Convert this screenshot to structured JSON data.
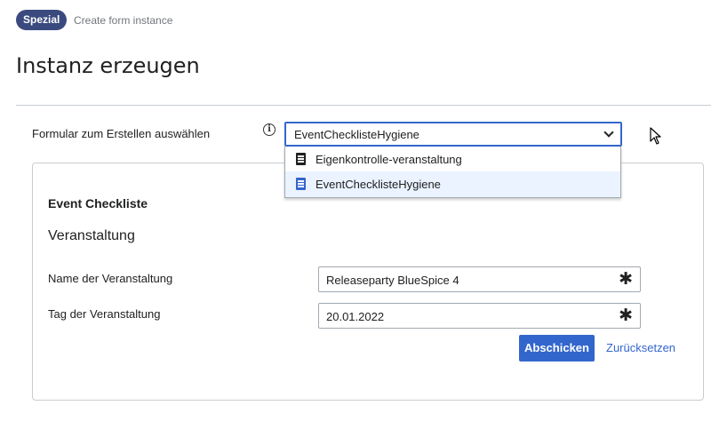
{
  "breadcrumb": {
    "badge": "Spezial",
    "text": "Create form instance"
  },
  "page": {
    "title": "Instanz erzeugen"
  },
  "form_select": {
    "label": "Formular zum Erstellen auswählen",
    "info_icon": "i",
    "selected": "EventChecklisteHygiene",
    "options": [
      {
        "label": "Eigenkontrolle-veranstaltung",
        "icon": "document-icon"
      },
      {
        "label": "EventChecklisteHygiene",
        "icon": "document-icon"
      }
    ]
  },
  "form": {
    "title": "Event Checkliste",
    "section": "Veranstaltung",
    "fields": [
      {
        "label": "Name der Veranstaltung",
        "value": "Releaseparty BlueSpice 4",
        "required_mark": "✱"
      },
      {
        "label": "Tag der Veranstaltung",
        "value": "20.01.2022",
        "required_mark": "✱"
      }
    ],
    "submit_label": "Abschicken",
    "reset_label": "Zurücksetzen"
  },
  "colors": {
    "accent": "#3366cc",
    "badge": "#3a4a7e",
    "selected_option_bg": "#eaf3ff"
  }
}
